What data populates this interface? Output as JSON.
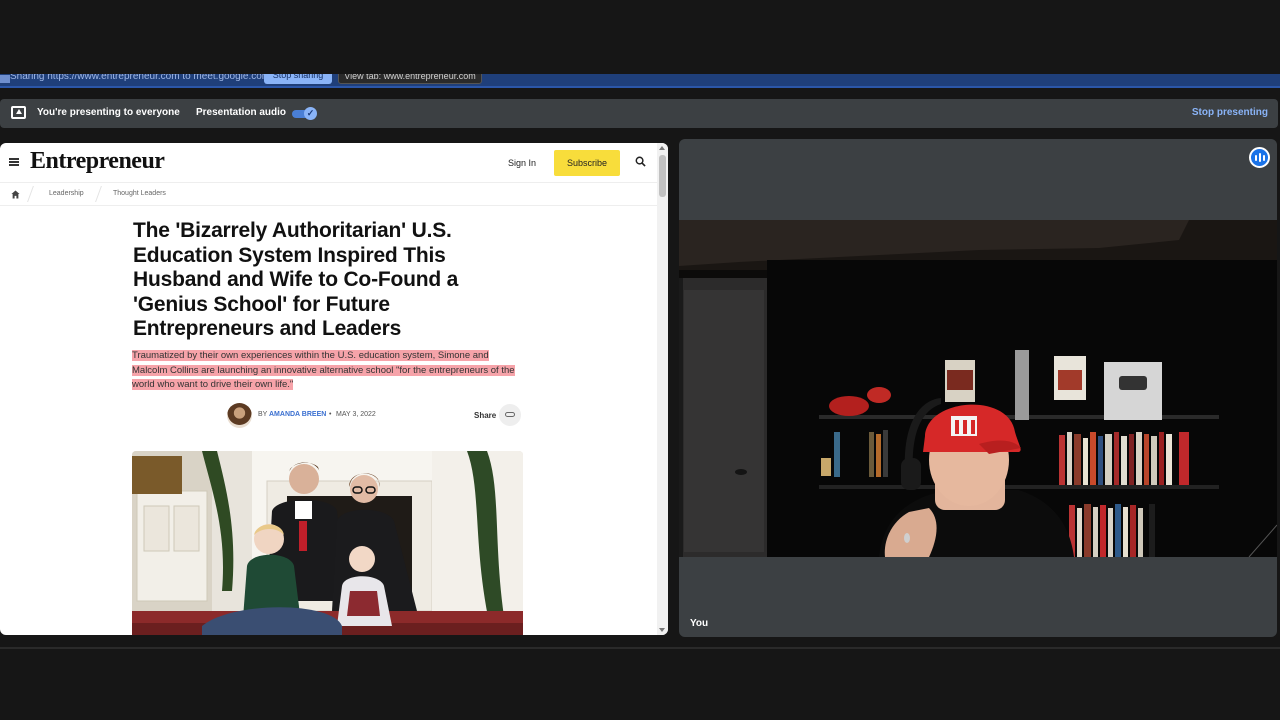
{
  "share_bar": {
    "text": "Sharing https://www.entrepreneur.com to meet.google.com",
    "stop_label": "Stop sharing",
    "view_label": "View tab: www.entrepreneur.com"
  },
  "presenting": {
    "status": "You're presenting to everyone",
    "audio_label": "Presentation audio",
    "audio_on": true,
    "toggle_check": "✓",
    "stop_label": "Stop presenting"
  },
  "article": {
    "brand": "Entrepreneur",
    "sign_in": "Sign In",
    "subscribe": "Subscribe",
    "breadcrumbs": [
      "Leadership",
      "Thought Leaders"
    ],
    "headline": "The 'Bizarrely Authoritarian' U.S. Education System Inspired This Husband and Wife to Co-Found a 'Genius School' for Future Entrepreneurs and Leaders",
    "dek": "Traumatized by their own experiences within the U.S. education system, Simone and Malcolm Collins are launching an innovative alternative school \"for the entrepreneurs of the world who want to drive their own life.\"",
    "by": "BY",
    "author": "AMANDA BREEN",
    "separator": "•",
    "date": "MAY 3, 2022",
    "share": "Share"
  },
  "participant": {
    "name": "You"
  },
  "colors": {
    "accent": "#8ab4f8",
    "subscribe": "#f8dd3b",
    "highlight": "#f6a3a9",
    "tile": "#3c4043",
    "hat": "#d62828"
  }
}
